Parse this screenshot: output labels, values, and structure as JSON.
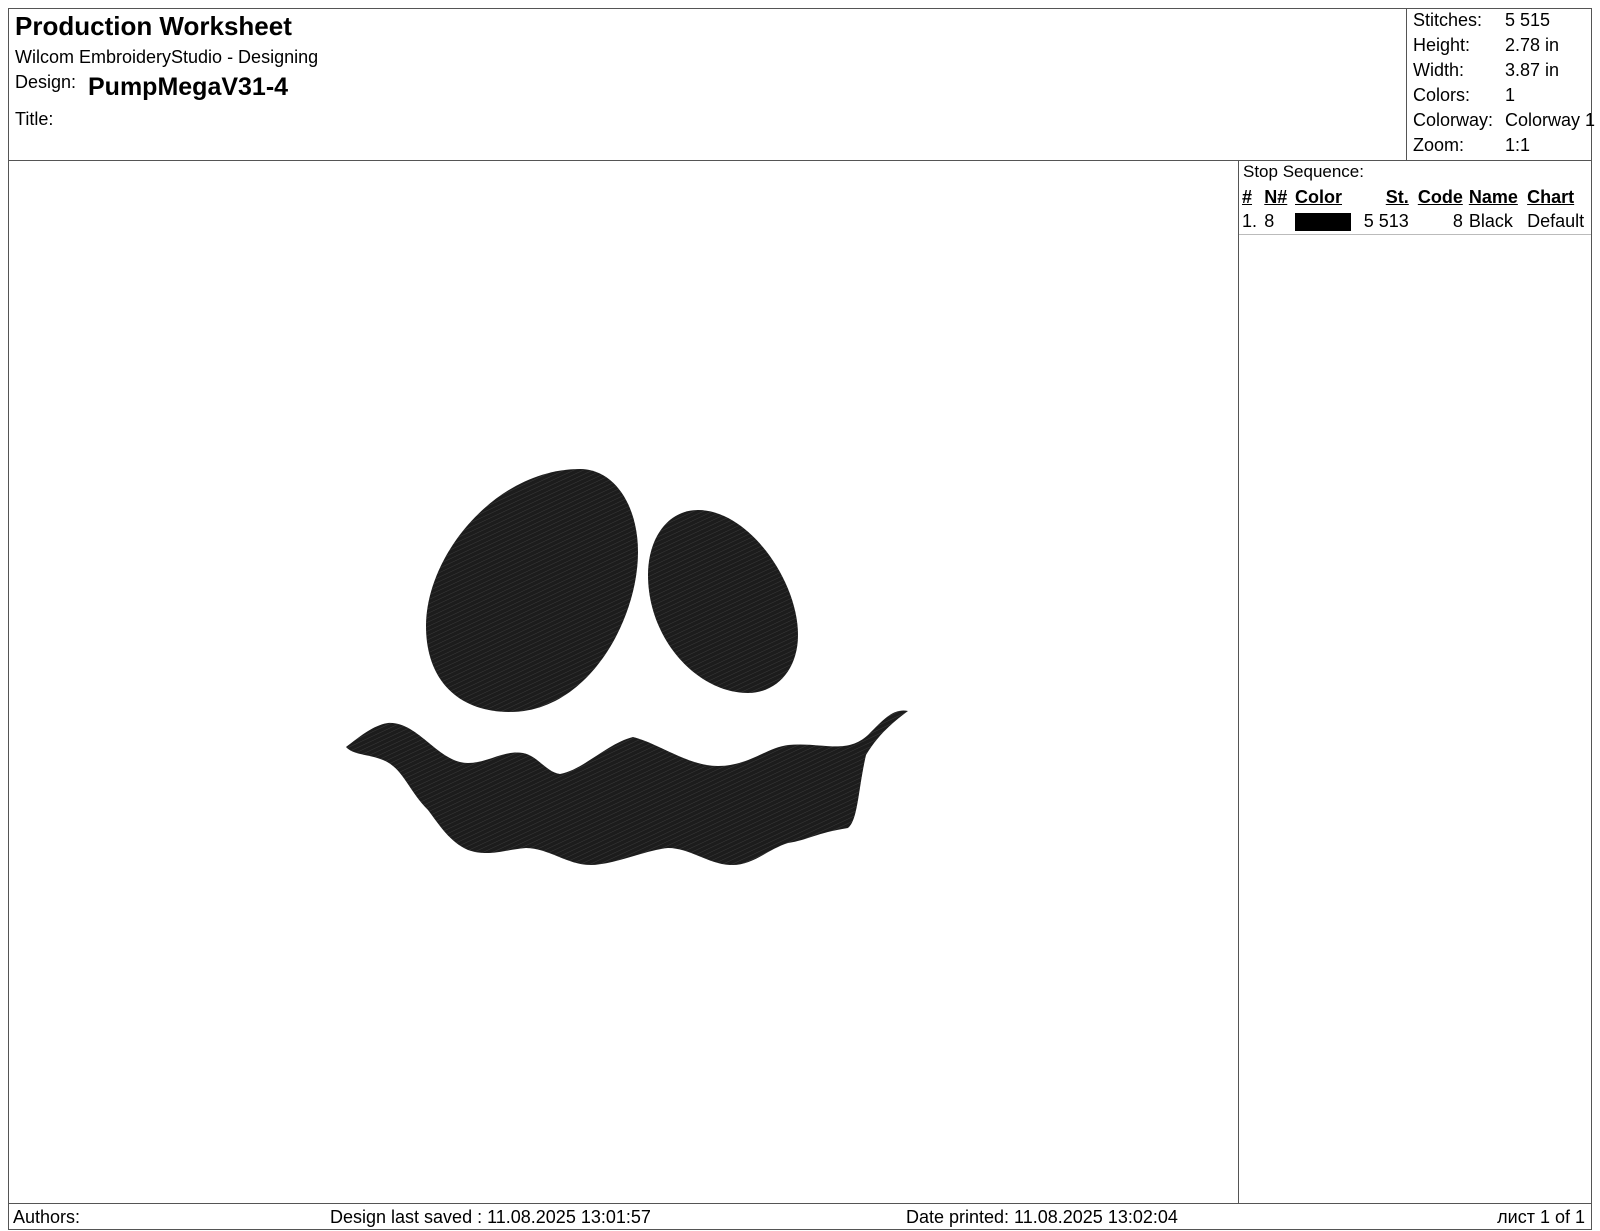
{
  "header": {
    "title": "Production Worksheet",
    "application": "Wilcom EmbroideryStudio - Designing",
    "design_label": "Design:",
    "design_name": "PumpMegaV31-4",
    "title_label": "Title:"
  },
  "specs": [
    {
      "label": "Stitches:",
      "value": "5 515"
    },
    {
      "label": "Height:",
      "value": "2.78 in"
    },
    {
      "label": "Width:",
      "value": "3.87 in"
    },
    {
      "label": "Colors:",
      "value": "1"
    },
    {
      "label": "Colorway:",
      "value": "Colorway 1"
    },
    {
      "label": "Zoom:",
      "value": "1:1"
    }
  ],
  "stop_sequence": {
    "title": "Stop Sequence:",
    "columns": [
      "#",
      "N#",
      "Color",
      "St.",
      "Code",
      "Name",
      "Chart"
    ],
    "rows": [
      {
        "num": "1.",
        "needle": "8",
        "color": "#000000",
        "stitches": "5 513",
        "code": "8",
        "name": "Black",
        "chart": "Default"
      }
    ]
  },
  "design_preview": {
    "thread_color": "#1c1c1c",
    "shapes": [
      "left-eye",
      "right-eye",
      "mouth"
    ]
  },
  "footer": {
    "authors_label": "Authors:",
    "last_saved": "Design last saved : 11.08.2025 13:01:57",
    "date_printed": "Date printed: 11.08.2025 13:02:04",
    "page": "лист 1 of 1"
  }
}
